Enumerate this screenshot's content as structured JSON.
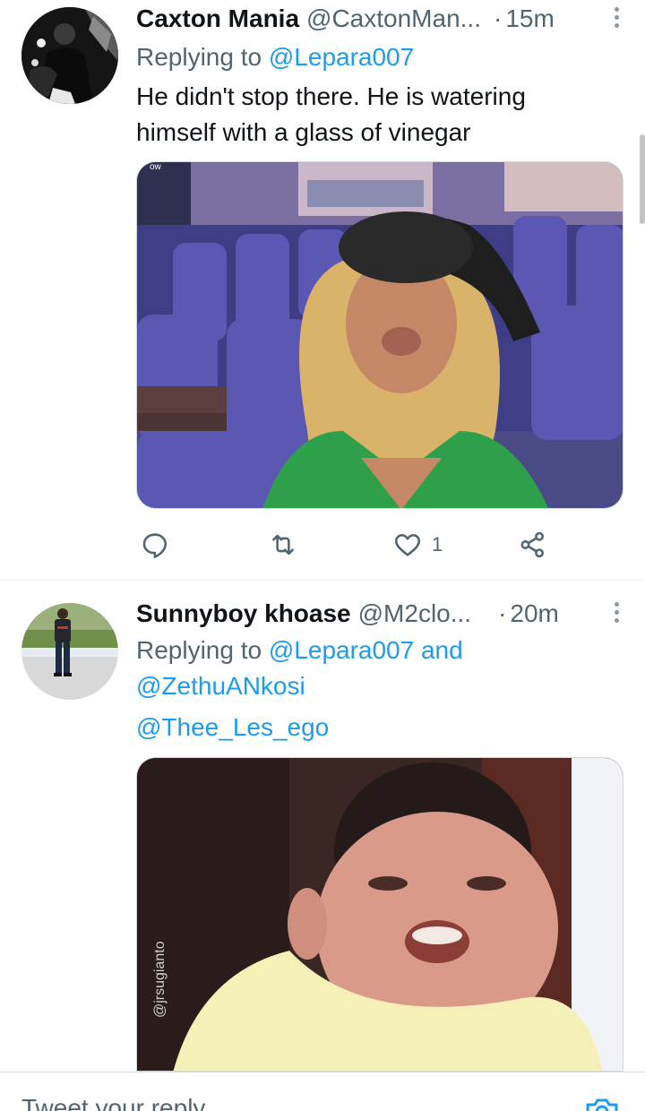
{
  "tweets": [
    {
      "display_name": "Caxton Mania",
      "handle": "@CaxtonMan...",
      "separator": "·",
      "time": "15m",
      "reply_prefix": "Replying to",
      "reply_mentions": "@Lepara007",
      "text_line1": "He didn't stop there. He is watering",
      "text_line2": "himself with a glass of vinegar",
      "like_count": "1",
      "media_watermark": "ow"
    },
    {
      "display_name": "Sunnyboy khoase",
      "handle": "@M2clo...",
      "separator": "·",
      "time": "20m",
      "reply_prefix": "Replying to",
      "reply_mention1": "@Lepara007",
      "reply_and": "and",
      "reply_mention2": "@ZethuANkosi",
      "text": "@Thee_Les_ego",
      "media_watermark": "@jrsugianto"
    }
  ],
  "composer": {
    "placeholder": "Tweet your reply"
  },
  "colors": {
    "accent": "#1d9bf0",
    "secondary_text": "#536471",
    "primary_text": "#0f1419"
  }
}
